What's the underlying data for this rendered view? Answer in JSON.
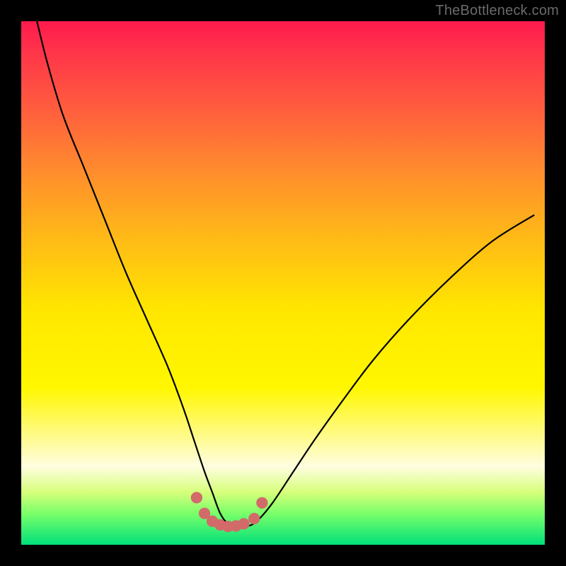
{
  "watermark": "TheBottleneck.com",
  "colors": {
    "frame_bg": "#000000",
    "gradient_top": "#ff1a4d",
    "gradient_bottom": "#00e07a",
    "curve_stroke": "#000000",
    "marker_fill": "#d26a6a",
    "watermark_text": "#6a6a6a"
  },
  "chart_data": {
    "type": "line",
    "title": "",
    "xlabel": "",
    "ylabel": "",
    "xlim": [
      0,
      100
    ],
    "ylim": [
      0,
      100
    ],
    "grid": false,
    "legend": false,
    "series": [
      {
        "name": "bottleneck-curve",
        "x": [
          3,
          5,
          8,
          12,
          16,
          20,
          24,
          28,
          31,
          33,
          35,
          36.5,
          38,
          39.5,
          41,
          43,
          45,
          48,
          52,
          56,
          61,
          67,
          74,
          82,
          90,
          98
        ],
        "y": [
          100,
          92,
          82,
          72,
          62,
          52,
          43,
          34,
          26,
          20,
          14,
          10,
          6,
          4,
          3.5,
          3.5,
          4.5,
          8,
          14,
          20,
          27,
          35,
          43,
          51,
          58,
          63
        ]
      }
    ],
    "markers": {
      "name": "valley-markers",
      "x": [
        33.5,
        35,
        36.5,
        38,
        39.5,
        41,
        42.5,
        44.5,
        46
      ],
      "y": [
        9,
        6,
        4.5,
        3.8,
        3.5,
        3.6,
        4,
        5,
        8
      ],
      "r": 1.1
    }
  }
}
